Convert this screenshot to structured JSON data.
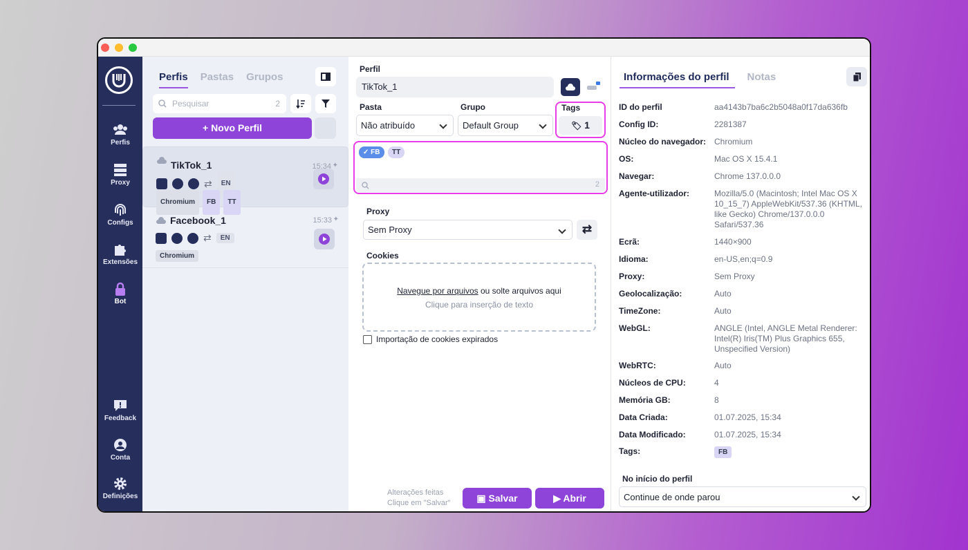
{
  "sidebar": {
    "items": [
      {
        "label": "Perfis",
        "icon": "users-icon"
      },
      {
        "label": "Proxy",
        "icon": "server-icon"
      },
      {
        "label": "Configs",
        "icon": "fingerprint-icon"
      },
      {
        "label": "Extensões",
        "icon": "puzzle-icon"
      },
      {
        "label": "Bot",
        "icon": "lock-icon"
      },
      {
        "label": "Feedback",
        "icon": "feedback-icon"
      },
      {
        "label": "Conta",
        "icon": "account-icon"
      },
      {
        "label": "Definições",
        "icon": "gear-icon"
      }
    ]
  },
  "list": {
    "tabs": [
      "Perfis",
      "Pastas",
      "Grupos"
    ],
    "search": {
      "placeholder": "Pesquisar",
      "count": "2"
    },
    "new_profile": "+ Novo Perfil",
    "profiles": [
      {
        "name": "TikTok_1",
        "time": "15:34",
        "lang": "EN",
        "tags": [
          "Chromium",
          "FB",
          "TT"
        ]
      },
      {
        "name": "Facebook_1",
        "time": "15:33",
        "lang": "EN",
        "tags": [
          "Chromium"
        ]
      }
    ]
  },
  "form": {
    "profile_label": "Perfil",
    "profile_name": "TikTok_1",
    "folder_label": "Pasta",
    "folder_value": "Não atribuído",
    "group_label": "Grupo",
    "group_value": "Default Group",
    "tags_label": "Tags",
    "tags_count": "1",
    "tag_chips": [
      "✓ FB",
      "TT"
    ],
    "tag_search_count": "2",
    "proxy_label": "Proxy",
    "proxy_value": "Sem Proxy",
    "cookies_label": "Cookies",
    "drop_link": "Navegue por arquivos",
    "drop_text": "ou solte arquivos aqui",
    "drop_hint": "Clique para inserção de texto",
    "expired_cookies": "Importação de cookies expirados",
    "changes_line1": "Alterações feitas",
    "changes_line2": "Clique em \"Salvar\"",
    "save": "Salvar",
    "open": "Abrir"
  },
  "info": {
    "tabs": [
      "Informações do perfil",
      "Notas"
    ],
    "rows": [
      {
        "k": "ID do perfil",
        "v": "aa4143b7ba6c2b5048a0f17da636fb"
      },
      {
        "k": "Config ID:",
        "v": "2281387"
      },
      {
        "k": "Núcleo do navegador:",
        "v": "Chromium"
      },
      {
        "k": "OS:",
        "v": "Mac OS X 15.4.1"
      },
      {
        "k": "Navegar:",
        "v": "Chrome 137.0.0.0"
      },
      {
        "k": "Agente-utilizador:",
        "v": "Mozilla/5.0 (Macintosh; Intel Mac OS X 10_15_7) AppleWebKit/537.36 (KHTML, like Gecko) Chrome/137.0.0.0 Safari/537.36"
      },
      {
        "k": "Ecrã:",
        "v": "1440×900"
      },
      {
        "k": "Idioma:",
        "v": "en-US,en;q=0.9"
      },
      {
        "k": "Proxy:",
        "v": "Sem Proxy"
      },
      {
        "k": "Geolocalização:",
        "v": "Auto"
      },
      {
        "k": "TimeZone:",
        "v": "Auto"
      },
      {
        "k": "WebGL:",
        "v": "ANGLE (Intel, ANGLE Metal Renderer: Intel(R) Iris(TM) Plus Graphics 655, Unspecified Version)"
      },
      {
        "k": "WebRTC:",
        "v": "Auto"
      },
      {
        "k": "Núcleos de CPU:",
        "v": "4"
      },
      {
        "k": "Memória GB:",
        "v": "8"
      },
      {
        "k": "Data Criada:",
        "v": "01.07.2025, 15:34"
      },
      {
        "k": "Data Modificado:",
        "v": "01.07.2025, 15:34"
      }
    ],
    "tags_label": "Tags:",
    "tags_value": "FB",
    "start_label": "No início do perfil",
    "start_value": "Continue de onde parou"
  }
}
